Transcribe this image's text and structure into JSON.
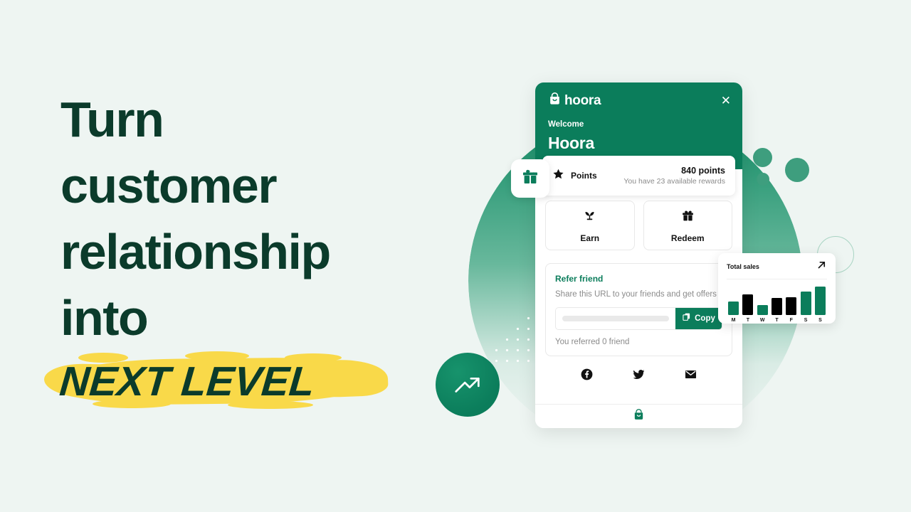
{
  "page": {
    "background_color": "#eef5f2",
    "brand_green": "#0b7d5b",
    "dark_green": "#0b3b2b",
    "highlight_yellow": "#f9d949"
  },
  "headline": {
    "lines": [
      "Turn",
      "customer",
      "relationship",
      "into"
    ],
    "emphasis": "NEXT LEVEL"
  },
  "widget": {
    "brand": "hoora",
    "close_label": "✕",
    "welcome_label": "Welcome",
    "user_name": "Hoora",
    "points": {
      "label": "Points",
      "value": "840 points",
      "subtitle": "You have 23 available rewards"
    },
    "actions": [
      {
        "label": "Earn",
        "icon": "sprout-icon"
      },
      {
        "label": "Redeem",
        "icon": "gift-icon"
      }
    ],
    "refer": {
      "title": "Refer friend",
      "subtitle": "Share this URL to your friends and get offers",
      "input_value": "",
      "input_placeholder": "",
      "copy_label": "Copy",
      "referred_text": "You referred 0 friend"
    },
    "social": [
      {
        "name": "facebook-icon"
      },
      {
        "name": "twitter-icon"
      },
      {
        "name": "email-icon"
      }
    ]
  },
  "sales_card": {
    "title": "Total sales",
    "arrow_icon": "arrow-up-right-icon"
  },
  "chart_data": {
    "type": "bar",
    "title": "Total sales",
    "categories": [
      "M",
      "T",
      "W",
      "T",
      "F",
      "S",
      "S"
    ],
    "values": [
      45,
      70,
      33,
      58,
      60,
      78,
      95
    ],
    "colors": [
      "#0b7d5b",
      "#000000",
      "#0b7d5b",
      "#000000",
      "#000000",
      "#0b7d5b",
      "#0b7d5b"
    ],
    "xlabel": "",
    "ylabel": "",
    "ylim": [
      0,
      100
    ],
    "grid": false,
    "legend": "none"
  }
}
